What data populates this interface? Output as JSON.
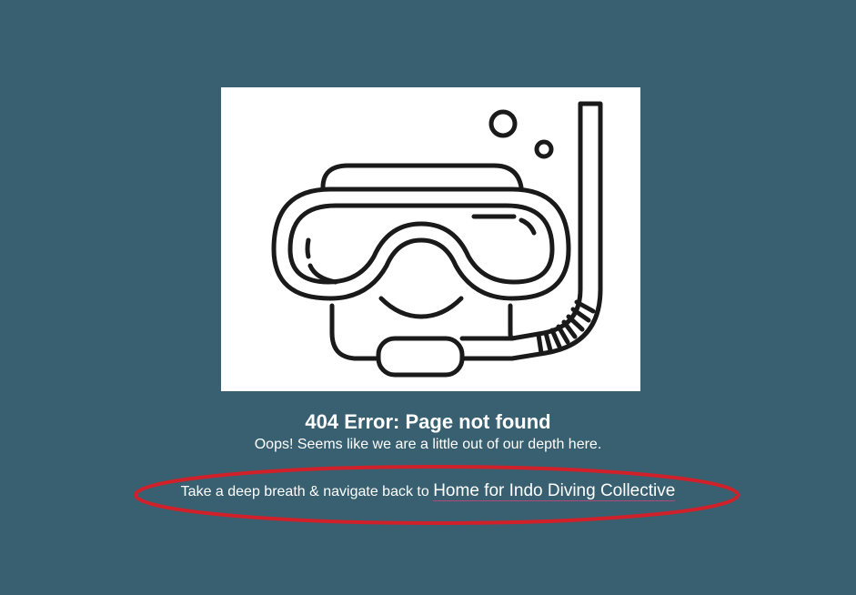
{
  "illustration": {
    "icon": "snorkel-mask-icon",
    "background": "#ffffff",
    "stroke": "#1a1a1a"
  },
  "error": {
    "title": "404 Error: Page not found",
    "subtitle": "Oops! Seems like we are a little out of our depth here."
  },
  "navigation": {
    "prefix": "Take a deep breath & navigate back to",
    "link_label": "Home for Indo Diving Collective"
  },
  "colors": {
    "background": "#386070",
    "text": "#ffffff",
    "annotation": "#d0202a",
    "link_underline": "#b04a7a"
  }
}
